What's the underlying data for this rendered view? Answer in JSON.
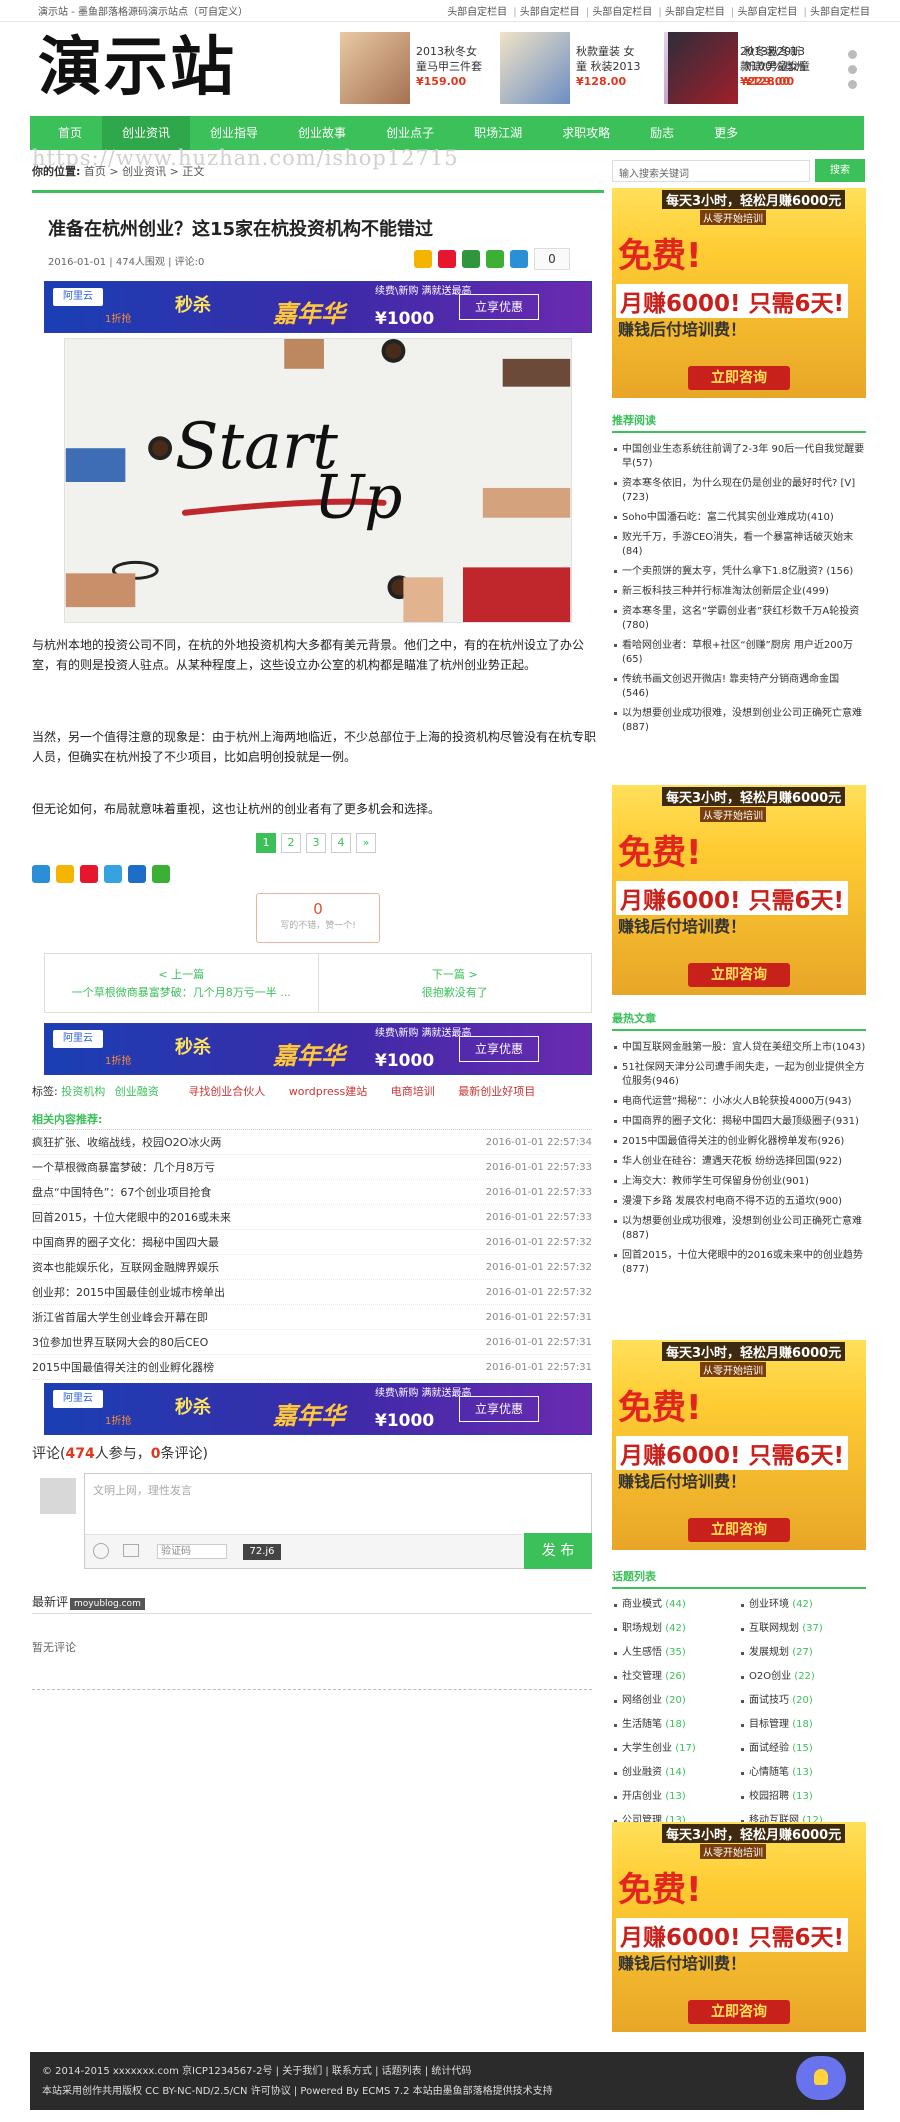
{
  "topbar": {
    "left": "演示站 - 墨鱼部落格源码演示站点（可自定义）",
    "links": [
      "头部自定栏目",
      "头部自定栏目",
      "头部自定栏目",
      "头部自定栏目",
      "头部自定栏目",
      "头部自定栏目"
    ]
  },
  "header": {
    "logo": "演示站",
    "ads": [
      {
        "line1": "2013秋冬女",
        "line2": "童马甲三件套",
        "price": "¥159.00"
      },
      {
        "line1": "秋款童装 女",
        "line2": "童 秋装2013",
        "price": "¥128.00"
      },
      {
        "line1": "2013秋冬新",
        "line2": "款100%澳洲",
        "price": "¥229.00"
      },
      {
        "line1": "秋冬装2013",
        "line2": "新款男童女童",
        "price": "¥128.00"
      }
    ]
  },
  "nav": [
    "首页",
    "创业资讯",
    "创业指导",
    "创业故事",
    "创业点子",
    "职场江湖",
    "求职攻略",
    "励志",
    "更多"
  ],
  "watermark_url": "https://www.huzhan.com/ishop12715",
  "breadcrumb": {
    "label": "你的位置:",
    "path": "首页 > 创业资讯 > 正文"
  },
  "search": {
    "placeholder": "输入搜索关键词",
    "button": "搜索"
  },
  "article": {
    "title": "准备在杭州创业？这15家在杭投资机构不能错过",
    "meta": "2016-01-01 | 474人围观 | 评论:0",
    "share_count": "0",
    "photo_text": {
      "line1": "Start",
      "line2": "Up"
    },
    "paragraphs": [
      "与杭州本地的投资公司不同，在杭的外地投资机构大多都有美元背景。他们之中，有的在杭州设立了办公室，有的则是投资人驻点。从某种程度上，这些设立办公室的机构都是瞄准了杭州创业势正起。",
      "当然，另一个值得注意的现象是：由于杭州上海两地临近，不少总部位于上海的投资机构尽管没有在杭专职人员，但确实在杭州投了不少项目，比如启明创投就是一例。",
      "但无论如何，布局就意味着重视，这也让杭州的创业者有了更多机会和选择。"
    ],
    "pages": [
      "1",
      "2",
      "3",
      "4",
      "»"
    ],
    "like_count": "0",
    "like_hint": "写的不错，赞一个!",
    "prev": {
      "label": "< 上一篇",
      "title": "一个草根微商暴富梦破：几个月8万亏一半 ..."
    },
    "next": {
      "label": "下一篇 >",
      "title": "很抱歉没有了"
    },
    "tags_label": "标签:",
    "tags": [
      "投资机构",
      "创业融资"
    ],
    "tag_links": [
      "寻找创业合伙人",
      "wordpress建站",
      "电商培训",
      "最新创业好项目"
    ],
    "related_title": "相关内容推荐:",
    "related": [
      {
        "title": "疯狂扩张、收缩战线，校园O2O冰火两",
        "date": "2016-01-01 22:57:34"
      },
      {
        "title": "一个草根微商暴富梦破：几个月8万亏",
        "date": "2016-01-01 22:57:33"
      },
      {
        "title": "盘点“中国特色”：67个创业项目抢食",
        "date": "2016-01-01 22:57:33"
      },
      {
        "title": "回首2015，十位大佬眼中的2016或未来",
        "date": "2016-01-01 22:57:33"
      },
      {
        "title": "中国商界的圈子文化：揭秘中国四大最",
        "date": "2016-01-01 22:57:32"
      },
      {
        "title": "资本也能娱乐化，互联网金融牌界娱乐",
        "date": "2016-01-01 22:57:32"
      },
      {
        "title": "创业邦：2015中国最佳创业城市榜单出",
        "date": "2016-01-01 22:57:32"
      },
      {
        "title": "浙江省首届大学生创业峰会开幕在即",
        "date": "2016-01-01 22:57:31"
      },
      {
        "title": "3位参加世界互联网大会的80后CEO",
        "date": "2016-01-01 22:57:31"
      },
      {
        "title": "2015中国最值得关注的创业孵化器榜",
        "date": "2016-01-01 22:57:31"
      }
    ],
    "comments": {
      "prefix": "评论(",
      "count_people": "474",
      "mid": "人参与，",
      "count_comments": "0",
      "suffix": "条评论)",
      "placeholder": "文明上网，理性发言",
      "captcha_placeholder": "验证码",
      "captcha_code": "72.j6",
      "send": "发 布",
      "latest_title": "最新评",
      "latest_mark": "moyublog.com",
      "empty": "暂无评论"
    }
  },
  "banner": {
    "brand": "阿里云",
    "title1": "秒杀",
    "title2": "嘉年华",
    "sub": "续费\\新购 满就送最高",
    "amount": "¥1000",
    "button": "立享优惠",
    "tag": "1折抢"
  },
  "side_ad": {
    "l1": "每天3小时，轻松月赚6000元",
    "l2": "从零开始培训",
    "l3": "免费!",
    "l4": "月赚6000! 只需6天!",
    "l5": "赚钱后付培训费！",
    "l6": "立即咨询"
  },
  "sidebar": {
    "recommend_title": "推荐阅读",
    "recommend": [
      "中国创业生态系统往前调了2-3年 90后一代自我觉醒要早(57)",
      "资本寒冬依旧，为什么现在仍是创业的最好时代? [V](723)",
      "Soho中国潘石屹：富二代其实创业难成功(410)",
      "败光千万，手游CEO消失，看一个暴富神话破灭始末(84)",
      "一个卖煎饼的冀太亨，凭什么拿下1.8亿融资? (156)",
      "新三板科技三种并行标准淘汰创新层企业(499)",
      "资本寒冬里，这名“学霸创业者”获红杉数千万A轮投资(780)",
      "看哈网创业者：草根+社区“创赚”厨房 用户近200万(65)",
      "传统书画文创迟开微店! 靠卖特产分销商遇命金国(546)",
      "以为想要创业成功很难，没想到创业公司正确死亡意难(887)"
    ],
    "latest_title": "最热文章",
    "latest": [
      "中国互联网金融第一股：宜人贷在美纽交所上市(1043)",
      "51社保网天津分公司遭手闹失走，一起为创业提供全方位服务(946)",
      "电商代运营“揭秘”：小冰火人B轮获投4000万(943)",
      "中国商界的圈子文化：揭秘中国四大最顶级圈子(931)",
      "2015中国最值得关注的创业孵化器榜单发布(926)",
      "华人创业在硅谷：遭遇天花板 纷纷选择回国(922)",
      "上海交大：教师学生可保留身份创业(901)",
      "漫漫下乡路 发展农村电商不得不迈的五道坎(900)",
      "以为想要创业成功很难，没想到创业公司正确死亡意难(887)",
      "回首2015，十位大佬眼中的2016或未来中的创业趋势(877)"
    ],
    "topics_title": "话题列表",
    "topics": [
      {
        "name": "商业模式",
        "count": "(44)"
      },
      {
        "name": "创业环境",
        "count": "(42)"
      },
      {
        "name": "职场规划",
        "count": "(42)"
      },
      {
        "name": "互联网规划",
        "count": "(37)"
      },
      {
        "name": "人生感悟",
        "count": "(35)"
      },
      {
        "name": "发展规划",
        "count": "(27)"
      },
      {
        "name": "社交管理",
        "count": "(26)"
      },
      {
        "name": "O2O创业",
        "count": "(22)"
      },
      {
        "name": "网络创业",
        "count": "(20)"
      },
      {
        "name": "面试技巧",
        "count": "(20)"
      },
      {
        "name": "生活随笔",
        "count": "(18)"
      },
      {
        "name": "目标管理",
        "count": "(18)"
      },
      {
        "name": "大学生创业",
        "count": "(17)"
      },
      {
        "name": "面试经验",
        "count": "(15)"
      },
      {
        "name": "创业融资",
        "count": "(14)"
      },
      {
        "name": "心情随笔",
        "count": "(13)"
      },
      {
        "name": "开店创业",
        "count": "(13)"
      },
      {
        "name": "校园招聘",
        "count": "(13)"
      },
      {
        "name": "公司管理",
        "count": "(13)"
      },
      {
        "name": "移动互联网",
        "count": "(12)"
      }
    ]
  },
  "footer": {
    "line1": "© 2014-2015 xxxxxxx.com 京ICP1234567-2号 | 关于我们 | 联系方式 | 话题列表 | 统计代码",
    "line2": "本站采用创作共用版权 CC BY-NC-ND/2.5/CN 许可协议 | Powered By ECMS 7.2 本站由墨鱼部落格提供技术支持"
  },
  "colors": {
    "accent": "#3cc05a",
    "price": "#e0361b"
  }
}
